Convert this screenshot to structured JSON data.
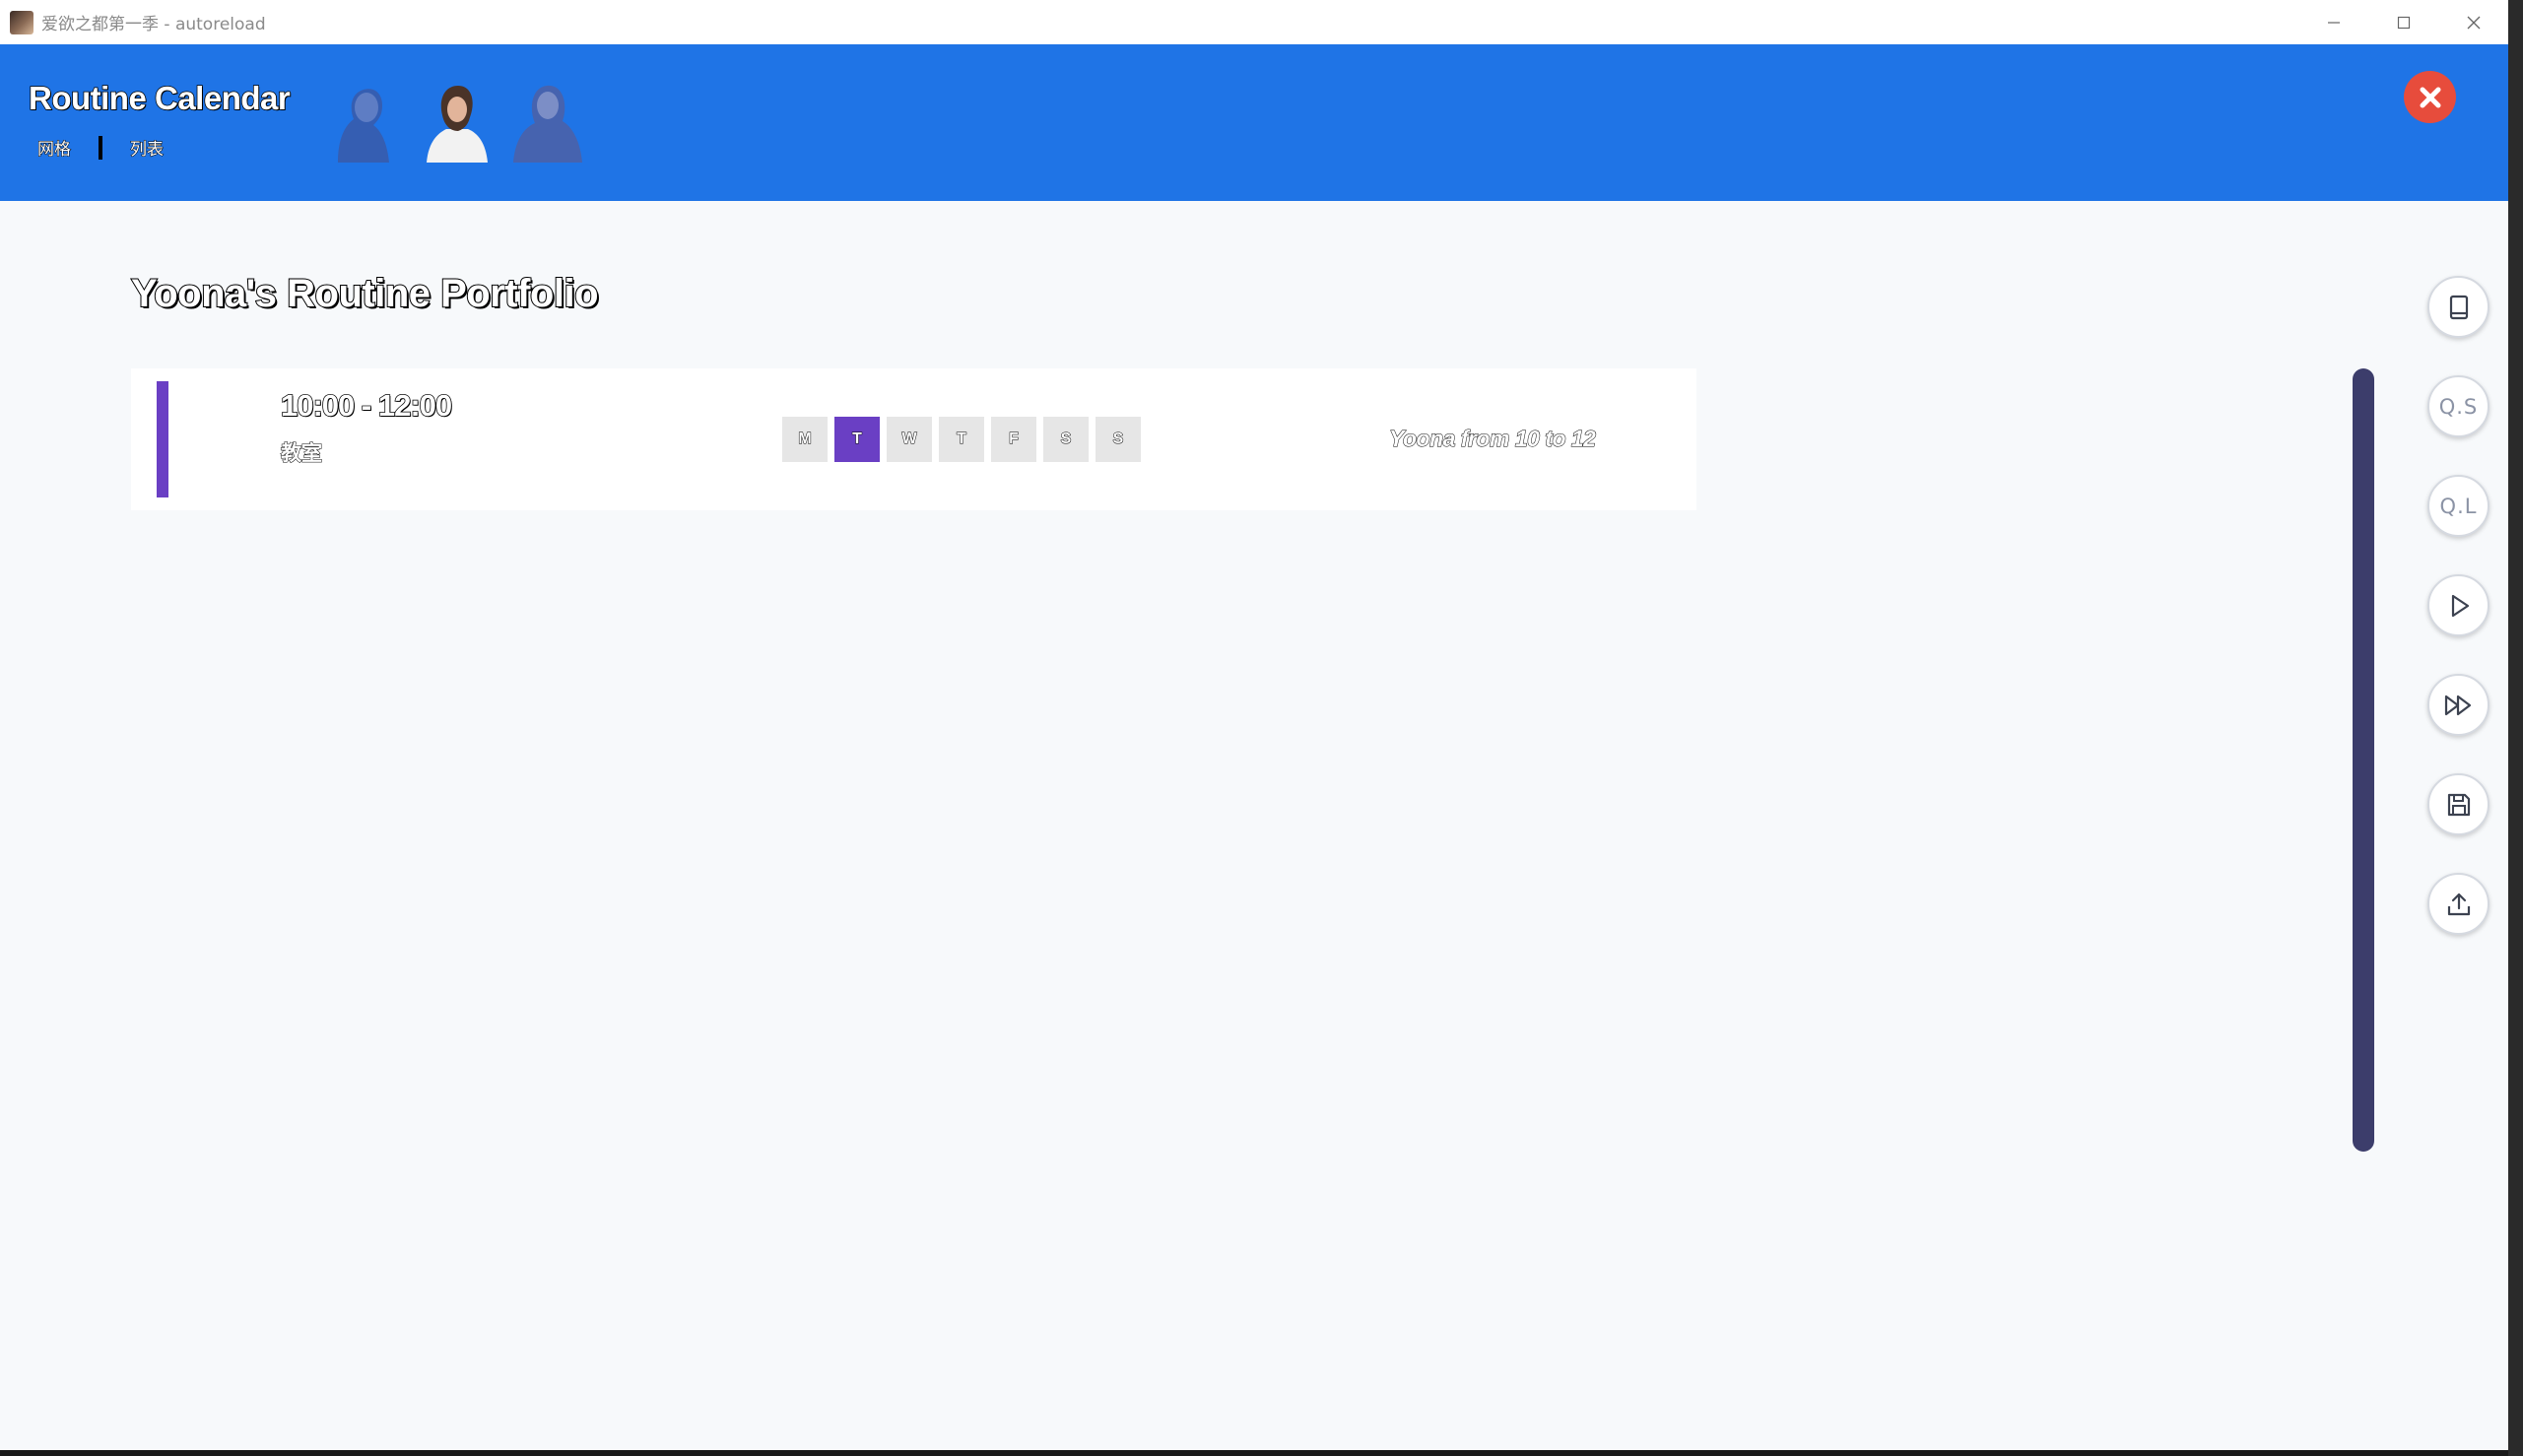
{
  "window": {
    "title": "爱欲之都第一季 - autoreload"
  },
  "header": {
    "title": "Routine Calendar",
    "tabs": [
      "网格",
      "列表"
    ]
  },
  "content": {
    "heading": "Yoona's Routine Portfolio",
    "routines": [
      {
        "time": "10:00 - 12:00",
        "location": "教室",
        "days": [
          "M",
          "T",
          "W",
          "T",
          "F",
          "S",
          "S"
        ],
        "active_day_index": 1,
        "description": "Yoona from 10 to 12"
      }
    ]
  },
  "quick_menu": {
    "items": [
      "history-icon",
      "Q.S",
      "Q.L",
      "play-icon",
      "skip-icon",
      "save-icon",
      "upload-icon"
    ]
  },
  "colors": {
    "header_bg": "#1f74e6",
    "accent": "#6a3fc4",
    "close": "#e74c3c",
    "scrollbar": "#3c3d6b",
    "page_bg": "#f7f9fb"
  }
}
